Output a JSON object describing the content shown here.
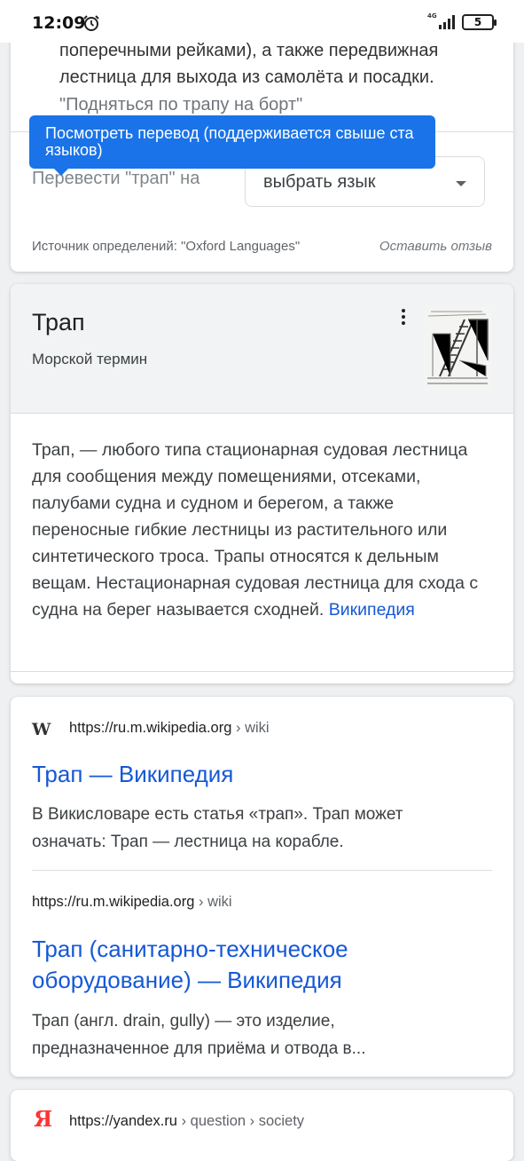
{
  "status_bar": {
    "time": "12:09",
    "network": "4G",
    "battery": "5"
  },
  "definition_card": {
    "lines": [
      "поперечными рейками), а также передвижная",
      "лестница для выхода из самолёта и посадки."
    ],
    "example": "\"Подняться по трапу на борт\"",
    "tooltip": "Посмотреть перевод (поддерживается свыше ста языков)",
    "translate_label": "Перевести \"трап\" на",
    "language_select": {
      "value": "выбрать язык"
    },
    "source": "Источник определений: \"Oxford Languages\"",
    "feedback": "Оставить отзыв"
  },
  "knowledge_panel": {
    "title": "Трап",
    "subtitle": "Морской термин",
    "image_icon": "ship-ladder-image",
    "body": "Трап, — любого типа стационарная судовая лестница для сообщения между помещениями, отсеками, палубами судна и судном и берегом, а также переносные гибкие лестницы из растительного или синтетического троса. Трапы относятся к дельным вещам. Нестационарная судовая лестница для схода с судна на берег называется сходней.",
    "link": "Википедия"
  },
  "results": [
    {
      "favicon": "W",
      "domain": "https://ru.m.wikipedia.org",
      "path": " › wiki",
      "title": "Трап — Википедия",
      "snippet_lines": [
        "В Викисловаре есть статья «трап». Трап может",
        "означать: Трап — лестница на корабле."
      ]
    },
    {
      "domain": "https://ru.m.wikipedia.org",
      "path": " › wiki",
      "title_lines": [
        "Трап (санитарно-техническое",
        "оборудование) — Википедия"
      ],
      "snippet_lines": [
        "Трап (англ. drain, gully) — это изделие,",
        "предназначенное для приёма и отвода в..."
      ]
    },
    {
      "favicon": "Я",
      "domain": "https://yandex.ru",
      "path": " › question › society"
    }
  ],
  "colors": {
    "link": "#1558d6",
    "tooltip": "#1a73e8",
    "panel_header": "#f1f3f4"
  }
}
